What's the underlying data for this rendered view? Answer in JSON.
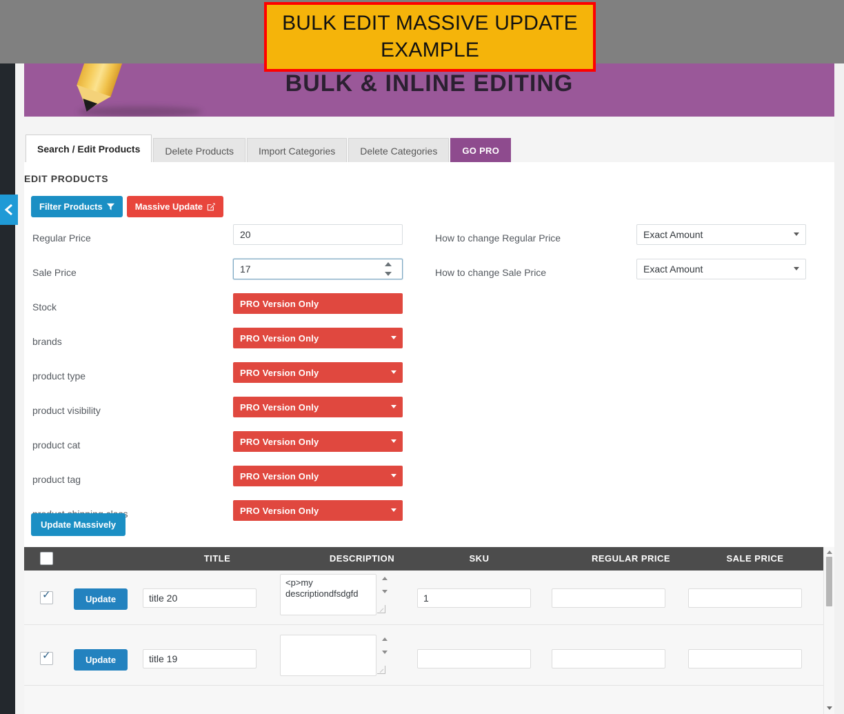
{
  "overlay": {
    "title": "BULK EDIT MASSIVE UPDATE EXAMPLE",
    "border_color": "#FF0000",
    "background_color": "#F5B40A"
  },
  "plugin_header": {
    "title": "BULK & INLINE EDITING",
    "background_color": "#9A5899",
    "icon": "pencil-icon"
  },
  "sidebar": {
    "collapse_icon": "chevron-left-icon",
    "accent_color": "#1f9ad6"
  },
  "tabs": [
    {
      "label": "Search / Edit Products",
      "active": true
    },
    {
      "label": "Delete Products",
      "active": false
    },
    {
      "label": "Import Categories",
      "active": false
    },
    {
      "label": "Delete Categories",
      "active": false
    },
    {
      "label": "GO PRO",
      "active": false,
      "style": "pro",
      "color": "#8E4B8E"
    }
  ],
  "section": {
    "title": "EDIT PRODUCTS"
  },
  "action_buttons": {
    "filter_products": {
      "label": "Filter Products",
      "icon": "funnel-icon",
      "color": "#1b8fc4"
    },
    "massive_update": {
      "label": "Massive Update",
      "icon": "edit-square-icon",
      "color": "#e8453c"
    }
  },
  "form": {
    "pro_text": "PRO Version Only",
    "rows": [
      {
        "label": "Regular Price",
        "control": "input",
        "value": "20",
        "focused": false,
        "right_label": "How to change Regular Price",
        "right_value": "Exact Amount"
      },
      {
        "label": "Sale Price",
        "control": "spinner",
        "value": "17",
        "focused": true,
        "right_label": "How to change Sale Price",
        "right_value": "Exact Amount"
      },
      {
        "label": "Stock",
        "control": "pro-flat"
      },
      {
        "label": "brands",
        "control": "pro-select"
      },
      {
        "label": "product type",
        "control": "pro-select"
      },
      {
        "label": "product visibility",
        "control": "pro-select"
      },
      {
        "label": "product cat",
        "control": "pro-select"
      },
      {
        "label": "product tag",
        "control": "pro-select"
      },
      {
        "label": "product shipping class",
        "control": "pro-select"
      }
    ],
    "submit_button": {
      "label": "Update Massively",
      "color": "#1b8fc4"
    }
  },
  "table": {
    "columns": [
      "TITLE",
      "DESCRIPTION",
      "SKU",
      "REGULAR PRICE",
      "SALE PRICE"
    ],
    "header_checkbox_checked": false,
    "row_button_label": "Update",
    "rows": [
      {
        "checked": true,
        "title": "title 20",
        "description": "<p>my descriptiondfsdgfd",
        "sku": "1",
        "regular_price": "",
        "sale_price": ""
      },
      {
        "checked": true,
        "title": "title 19",
        "description": "",
        "sku": "",
        "regular_price": "",
        "sale_price": ""
      }
    ]
  }
}
